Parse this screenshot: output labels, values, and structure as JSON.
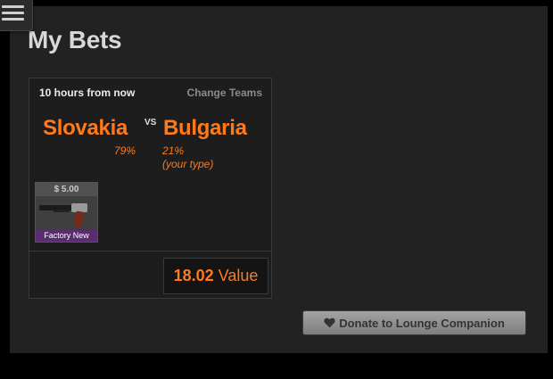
{
  "page": {
    "title": "My Bets"
  },
  "menu": {
    "icon": "hamburger-menu-icon"
  },
  "bet": {
    "time": "10 hours from now",
    "change_teams": "Change Teams",
    "team_a": {
      "name": "Slovakia",
      "percent": "79%"
    },
    "vs": "VS",
    "team_b": {
      "name": "Bulgaria",
      "percent": "21%",
      "note": "(your type)"
    },
    "item": {
      "price": "$ 5.00",
      "condition": "Factory New",
      "icon": "pistol-weapon-icon"
    },
    "value": {
      "amount": "18.02",
      "label": "Value"
    }
  },
  "donate": {
    "label": "Donate to Lounge Companion",
    "icon": "heart-icon"
  },
  "colors": {
    "accent": "#ff7a1a",
    "panel": "#222222",
    "condition_badge": "#5a2d73"
  }
}
